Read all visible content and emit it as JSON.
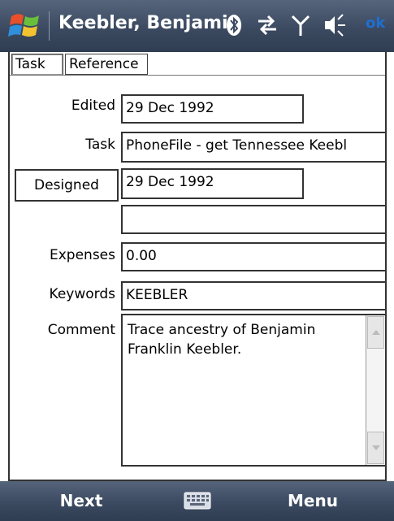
{
  "titlebar": {
    "title": "Keebler, Benjamin",
    "ok_label": "ok",
    "icons": [
      "windows-start-icon",
      "bluetooth-icon",
      "data-sync-icon",
      "signal-icon",
      "volume-icon"
    ]
  },
  "tabs": [
    {
      "label": "Task",
      "active": true
    },
    {
      "label": "Reference",
      "active": false
    }
  ],
  "form": {
    "edited": {
      "label": "Edited",
      "value": "29 Dec 1992"
    },
    "task": {
      "label": "Task",
      "value": "PhoneFile - get Tennessee Keebl"
    },
    "designed": {
      "label": "Designed",
      "value": "29 Dec 1992"
    },
    "blank": {
      "value": ""
    },
    "expenses": {
      "label": "Expenses",
      "value": "0.00"
    },
    "keywords": {
      "label": "Keywords",
      "value": "KEEBLER"
    },
    "comment": {
      "label": "Comment",
      "value": "Trace ancestry of Benjamin Franklin Keebler."
    }
  },
  "softkeys": {
    "left": "Next",
    "right": "Menu",
    "center_icon": "keyboard-icon"
  },
  "colors": {
    "bar_top": "#56657c",
    "bar_bottom": "#2f3d52",
    "ok_blue": "#1f6fd0"
  }
}
